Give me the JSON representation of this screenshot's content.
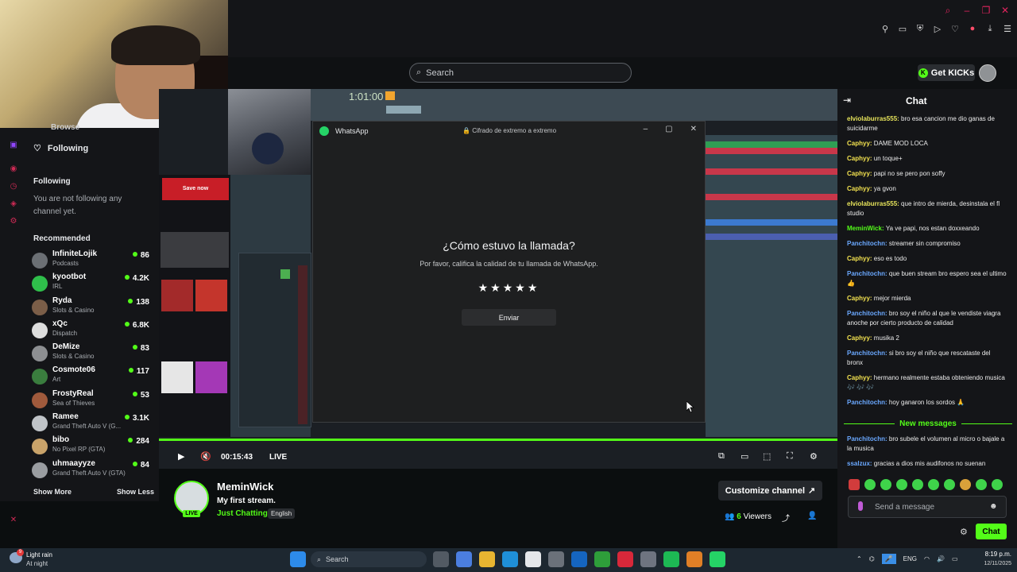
{
  "header": {
    "search_placeholder": "Search",
    "get_kicks": "Get KICKs"
  },
  "sidebar": {
    "browse": "Browse",
    "following_nav": "Following",
    "following_heading": "Following",
    "not_following": "You are not following any channel yet.",
    "recommended_heading": "Recommended",
    "recommended": [
      {
        "name": "InfiniteLojik",
        "category": "Podcasts",
        "viewers": "86"
      },
      {
        "name": "kyootbot",
        "category": "IRL",
        "viewers": "4.2K"
      },
      {
        "name": "Ryda",
        "category": "Slots & Casino",
        "viewers": "138"
      },
      {
        "name": "xQc",
        "category": "Dispatch",
        "viewers": "6.8K"
      },
      {
        "name": "DeMize",
        "category": "Slots & Casino",
        "viewers": "83"
      },
      {
        "name": "Cosmote06",
        "category": "Art",
        "viewers": "117"
      },
      {
        "name": "FrostyReal",
        "category": "Sea of Thieves",
        "viewers": "53"
      },
      {
        "name": "Ramee",
        "category": "Grand Theft Auto V (G...",
        "viewers": "3.1K"
      },
      {
        "name": "bibo",
        "category": "No Pixel RP (GTA)",
        "viewers": "284"
      },
      {
        "name": "uhmaayyze",
        "category": "Grand Theft Auto V (GTA)",
        "viewers": "84"
      }
    ],
    "show_more": "Show More",
    "show_less": "Show Less"
  },
  "video": {
    "save_now": "Save now",
    "fl_time": "1:01:00",
    "time": "00:15:43",
    "live": "LIVE"
  },
  "whatsapp": {
    "title": "WhatsApp",
    "encryption": "Cifrado de extremo a extremo",
    "question": "¿Cómo estuvo la llamada?",
    "subtitle": "Por favor, califica la calidad de tu llamada de WhatsApp.",
    "stars": "★★★★★",
    "rating_max": 5,
    "send": "Enviar"
  },
  "streamer": {
    "name": "MeminWick",
    "title": "My first stream.",
    "category": "Just Chatting",
    "language": "English",
    "customize": "Customize channel",
    "viewers_count": "6",
    "viewers_label": "Viewers",
    "live_badge": "LIVE"
  },
  "chat": {
    "title": "Chat",
    "messages": [
      {
        "user": "elviolaburras555",
        "color": "#e7e45b",
        "text": "bro esa cancion me dio ganas de suicidarme"
      },
      {
        "user": "Caphyy",
        "color": "#f2e14f",
        "text": "DAME MOD LOCA"
      },
      {
        "user": "Caphyy",
        "color": "#f2e14f",
        "text": "un toque+"
      },
      {
        "user": "Caphyy",
        "color": "#f2e14f",
        "text": "papi no se pero pon soffy"
      },
      {
        "user": "Caphyy",
        "color": "#f2e14f",
        "text": "ya gvon"
      },
      {
        "user": "elviolaburras555",
        "color": "#e7e45b",
        "text": "que intro de mierda, desinstala el fl studio"
      },
      {
        "user": "MeminWick",
        "color": "#53fc18",
        "text": "Ya ve papi, nos estan doxxeando"
      },
      {
        "user": "Panchitochn",
        "color": "#6aa8ff",
        "text": "streamer sin compromiso"
      },
      {
        "user": "Caphyy",
        "color": "#f2e14f",
        "text": "eso es todo"
      },
      {
        "user": "Panchitochn",
        "color": "#6aa8ff",
        "text": "que buen stream bro espero sea el ultimo 👍"
      },
      {
        "user": "Caphyy",
        "color": "#f2e14f",
        "text": "mejor mierda"
      },
      {
        "user": "Panchitochn",
        "color": "#6aa8ff",
        "text": "bro soy el niño al que le vendiste viagra anoche por cierto producto de calidad"
      },
      {
        "user": "Caphyy",
        "color": "#f2e14f",
        "text": "musika 2"
      },
      {
        "user": "Panchitochn",
        "color": "#6aa8ff",
        "text": "si bro soy el niño que rescataste del bronx"
      },
      {
        "user": "Caphyy",
        "color": "#f2e14f",
        "text": "hermano realmente estaba obteniendo musica 🎶 🎶 🎶"
      },
      {
        "user": "Panchitochn",
        "color": "#6aa8ff",
        "text": "hoy ganaron los sordos 🙏"
      }
    ],
    "new_messages": "New messages",
    "new": [
      {
        "user": "Panchitochn",
        "color": "#6aa8ff",
        "text": "bro subele el volumen al micro o bajale a la musica"
      },
      {
        "user": "ssalzux",
        "color": "#6aa8ff",
        "text": "gracias a dios mis audifonos no suenan"
      }
    ],
    "input_placeholder": "Send a message",
    "send_button": "Chat"
  },
  "taskbar": {
    "weather": "Light rain",
    "weather_sub": "At night",
    "weather_badge": "9",
    "search": "Search",
    "lang": "ENG",
    "time": "8:19 p.m.",
    "date": "12/11/2025"
  },
  "colors": {
    "accent": "#53fc18",
    "panel": "#141518"
  }
}
